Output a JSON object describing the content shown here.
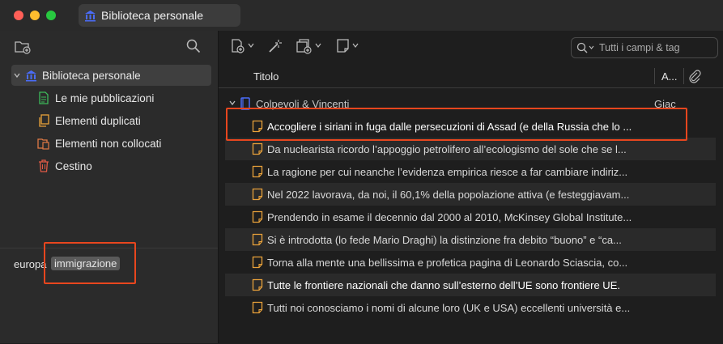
{
  "window": {
    "tab_title": "Biblioteca personale"
  },
  "sidebar": {
    "root": {
      "label": "Biblioteca personale"
    },
    "items": [
      {
        "label": "Le mie pubblicazioni",
        "icon": "document-icon",
        "color": "#3dbb5a"
      },
      {
        "label": "Elementi duplicati",
        "icon": "duplicate-icon",
        "color": "#e8a13a"
      },
      {
        "label": "Elementi non collocati",
        "icon": "unfiled-icon",
        "color": "#e07a45"
      },
      {
        "label": "Cestino",
        "icon": "trash-icon",
        "color": "#e05a45"
      }
    ]
  },
  "tags": {
    "word": "europa",
    "chip": "immigrazione"
  },
  "toolbar": {
    "search_placeholder": "Tutti i campi & tag"
  },
  "columns": {
    "title": "Titolo",
    "author": "A..."
  },
  "group": {
    "label": "Colpevoli & Vincenti",
    "right": "Giac"
  },
  "rows": [
    {
      "text": "Accogliere i siriani in fuga dalle persecuzioni di Assad (e della Russia che lo ...",
      "bright": true
    },
    {
      "text": "Da nuclearista ricordo l’appoggio petrolifero all’ecologismo del sole che se l...",
      "bright": false
    },
    {
      "text": "La ragione per cui neanche l’evidenza empirica riesce a far cambiare indiriz...",
      "bright": false
    },
    {
      "text": "Nel 2022 lavorava, da noi, il 60,1% della popolazione attiva (e festeggiavam...",
      "bright": false
    },
    {
      "text": "Prendendo in esame il decennio dal 2000 al 2010, McKinsey Global Institute...",
      "bright": false
    },
    {
      "text": "Si è introdotta (lo fede Mario Draghi) la distinzione fra debito “buono” e “ca...",
      "bright": false
    },
    {
      "text": "Torna alla mente una bellissima e profetica pagina di Leonardo Sciascia, co...",
      "bright": false
    },
    {
      "text": "Tutte le frontiere nazionali che danno sull’esterno dell’UE sono frontiere UE.",
      "bright": true
    },
    {
      "text": "Tutti noi conosciamo i nomi di alcune loro (UK e USA) eccellenti università e...",
      "bright": false
    }
  ],
  "colors": {
    "highlight": "#e8461e",
    "library_icon": "#4a6cf7"
  }
}
